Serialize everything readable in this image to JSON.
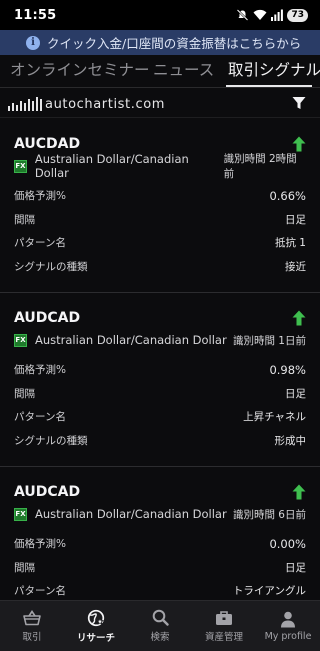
{
  "status_bar": {
    "time": "11:55",
    "battery": "73",
    "icons": [
      "mute-icon",
      "wifi-icon",
      "signal-icon",
      "battery-icon"
    ]
  },
  "banner": {
    "icon": "info-icon",
    "text": "クイック入金/口座間の資金振替はこちらから",
    "color": "#2a3c66"
  },
  "tabs": [
    {
      "label": "オンラインセミナー",
      "active": false
    },
    {
      "label": "ニュース",
      "active": false
    },
    {
      "label": "取引シグナル",
      "active": true
    }
  ],
  "brand": {
    "name": "autochartist.com",
    "filter_icon": "filter-icon"
  },
  "labels": {
    "forecast": "価格予測%",
    "interval": "間隔",
    "pattern": "パターン名",
    "signal_type": "シグナルの種類"
  },
  "signals": [
    {
      "symbol": "AUCDAD",
      "badge": "FX",
      "pair": "Australian Dollar/Canadian Dollar",
      "identified": "識別時間 2時間前",
      "direction": "up",
      "forecast": "0.66%",
      "interval": "日足",
      "pattern": "抵抗 1",
      "signal_type": "接近"
    },
    {
      "symbol": "AUDCAD",
      "badge": "FX",
      "pair": "Australian Dollar/Canadian Dollar",
      "identified": "識別時間 1日前",
      "direction": "up",
      "forecast": "0.98%",
      "interval": "日足",
      "pattern": "上昇チャネル",
      "signal_type": "形成中"
    },
    {
      "symbol": "AUDCAD",
      "badge": "FX",
      "pair": "Australian Dollar/Canadian Dollar",
      "identified": "識別時間 6日前",
      "direction": "up",
      "forecast": "0.00%",
      "interval": "日足",
      "pattern": "トライアングル",
      "signal_type": ""
    }
  ],
  "bottom_nav": [
    {
      "label": "取引",
      "icon": "basket-icon",
      "active": false
    },
    {
      "label": "リサーチ",
      "icon": "globe-star-icon",
      "active": true
    },
    {
      "label": "検索",
      "icon": "search-icon",
      "active": false
    },
    {
      "label": "資産管理",
      "icon": "briefcase-icon",
      "active": false
    },
    {
      "label": "My profile",
      "icon": "person-icon",
      "active": false
    }
  ],
  "colors": {
    "background": "#0c0c0e",
    "up_arrow": "#3fbf4f",
    "fx_badge": "#1f7a2b",
    "nav_background": "#1b1b1e"
  }
}
